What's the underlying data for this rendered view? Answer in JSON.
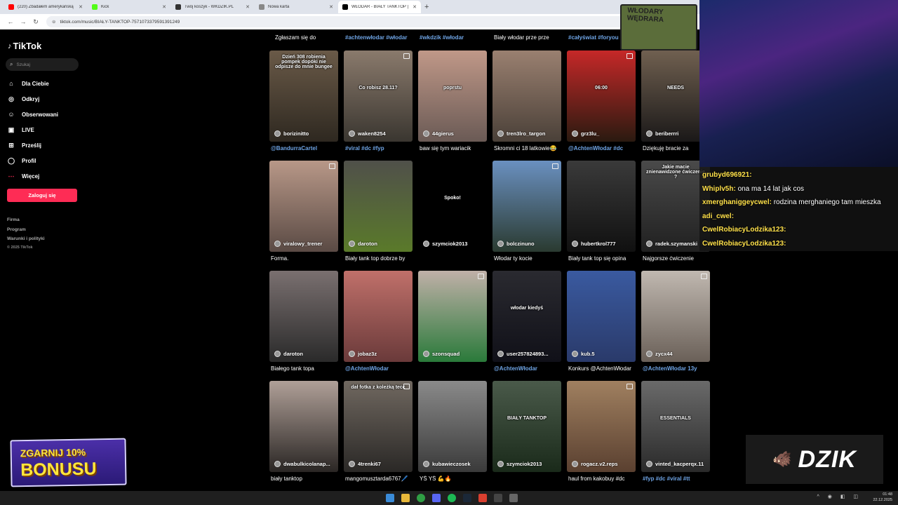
{
  "browser": {
    "tabs": [
      {
        "title": "(220) Zbadałem amerykańską",
        "icon_color": "#ff0000"
      },
      {
        "title": "Kick",
        "icon_color": "#53fc18"
      },
      {
        "title": "Twój koszyk - WKDZIK.PL",
        "icon_color": "#333333"
      },
      {
        "title": "Nowa karta",
        "icon_color": "#888888"
      },
      {
        "title": "WŁODAR - BIAŁY TANKTOP | Ti",
        "icon_color": "#000000"
      }
    ],
    "url": "tiktok.com/music/BIAŁY-TANKTOP-7571073379591391249"
  },
  "tiktok": {
    "logo": "TikTok",
    "search_placeholder": "Szukaj",
    "nav": [
      "Dla Ciebie",
      "Odkryj",
      "Obserwowani",
      "LIVE",
      "Prześlij",
      "Profil",
      "Więcej"
    ],
    "login": "Zaloguj się",
    "footer": [
      "Firma",
      "Program",
      "Warunki i polityki"
    ],
    "copyright": "© 2025 TikTok",
    "top_captions": [
      "Zgłaszam się do",
      "#achtenwłodar #włodar",
      "#wkdzik #włodar",
      "Biały włodar prze prze",
      "#całyświat #foryou"
    ],
    "rows": [
      [
        {
          "user": "borizinitto",
          "overlay": "Dzień 308 robienia pompek dopóki nie odpisze do mnie bungee",
          "caption": "@BandurraCartel",
          "caption_blue": true,
          "colors": [
            "#6a5a48",
            "#2e2820"
          ]
        },
        {
          "user": "waken8254",
          "overlay": "Co robisz 28.11?",
          "caption": "#viral #dc #fyp",
          "caption_blue": true,
          "colors": [
            "#8a7a6c",
            "#3a3630"
          ]
        },
        {
          "user": "44gierus",
          "overlay": "poprstu",
          "caption": "baw się tym wariacik",
          "caption_blue": false,
          "colors": [
            "#c09888",
            "#6a5a55"
          ]
        },
        {
          "user": "tren3lro_targon",
          "overlay": "",
          "caption": "Skromni ci 18 latkowie😂",
          "caption_blue": false,
          "colors": [
            "#9a8070",
            "#4a4038"
          ]
        },
        {
          "user": "grz3lu_",
          "overlay": "06:00",
          "caption": "@AchtenWłodar #dc",
          "caption_blue": true,
          "colors": [
            "#c62828",
            "#2a1a10"
          ]
        },
        {
          "user": "beriberrri",
          "overlay": "NEEDS",
          "caption": "Dziękuję bracie za",
          "caption_blue": false,
          "colors": [
            "#706050",
            "#1a1818"
          ]
        }
      ],
      [
        {
          "user": "viralowy_trener",
          "overlay": "",
          "caption": "Forma.",
          "caption_blue": false,
          "colors": [
            "#b89888",
            "#5a4a44"
          ]
        },
        {
          "user": "daroton",
          "overlay": "",
          "caption": "Biały tank top dobrze by",
          "caption_blue": false,
          "colors": [
            "#50504a",
            "#5a7a2a"
          ]
        },
        {
          "user": "szymciok2013",
          "overlay": "Spoko!",
          "caption": "",
          "caption_blue": false,
          "colors": [
            "#000000",
            "#000000"
          ]
        },
        {
          "user": "bolczinuno",
          "overlay": "",
          "caption": "Włodar ty kocie",
          "caption_blue": false,
          "colors": [
            "#6a90c0",
            "#2a3a30"
          ]
        },
        {
          "user": "hubertkrol777",
          "overlay": "",
          "caption": "Biały tank top się opina",
          "caption_blue": false,
          "colors": [
            "#3a3a3a",
            "#101010"
          ]
        },
        {
          "user": "radek.szymanski",
          "overlay": "Jakie macie znienawidzone ćwiczenie ?",
          "caption": "Najgorsze ćwiczenie",
          "caption_blue": false,
          "colors": [
            "#4a4a4a",
            "#202020"
          ]
        }
      ],
      [
        {
          "user": "daroton",
          "overlay": "",
          "caption": "Białego tank topa",
          "caption_blue": false,
          "colors": [
            "#7a7070",
            "#2a2a2a"
          ]
        },
        {
          "user": "jobaz3z",
          "overlay": "",
          "caption": "@AchtenWłodar",
          "caption_blue": true,
          "colors": [
            "#c0706a",
            "#6a3a3a"
          ]
        },
        {
          "user": "szonsquad",
          "overlay": "",
          "caption": "",
          "caption_blue": false,
          "colors": [
            "#c0b0a8",
            "#2a7a3a"
          ]
        },
        {
          "user": "user257824893...",
          "overlay": "włodar kiedyś",
          "caption": "@AchtenWłodar",
          "caption_blue": true,
          "colors": [
            "#2a2a30",
            "#101018"
          ]
        },
        {
          "user": "kub.5",
          "overlay": "",
          "caption": "Konkurs @AchtenWłodar",
          "caption_blue": false,
          "colors": [
            "#3a5aa0",
            "#2a3a6a"
          ]
        },
        {
          "user": "zycx44",
          "overlay": "",
          "caption": "@AchtenWłodar 13y",
          "caption_blue": true,
          "colors": [
            "#c0b8b0",
            "#6a6058"
          ]
        }
      ],
      [
        {
          "user": "dwabulkicolanap...",
          "overlay": "",
          "caption": "biały tanktop",
          "caption_blue": false,
          "colors": [
            "#b0a098",
            "#2a2624"
          ]
        },
        {
          "user": "4trenki67",
          "overlay": "dał fotka z koleżką tecc",
          "caption": "mangomusztarda6767🖊️",
          "caption_blue": false,
          "colors": [
            "#706860",
            "#2a2826"
          ]
        },
        {
          "user": "kubawieczosek",
          "overlay": "",
          "caption": "YŚ YŚ 💪🔥",
          "caption_blue": false,
          "colors": [
            "#8a8a8a",
            "#3a3a3a"
          ]
        },
        {
          "user": "szymciok2013",
          "overlay": "BIAŁY TANKTOP",
          "caption": "",
          "caption_blue": false,
          "colors": [
            "#4a5a4a",
            "#1a2a1a"
          ]
        },
        {
          "user": "rogacz.v2.reps",
          "overlay": "",
          "caption": "haul from kakobuy #dc",
          "caption_blue": false,
          "colors": [
            "#a08060",
            "#5a4030"
          ]
        },
        {
          "user": "vinted_kacperqx.11",
          "overlay": "ESSENTIALS",
          "caption": "#fyp #dc #viral #tt",
          "caption_blue": true,
          "colors": [
            "#6a6a6a",
            "#2a2a2a"
          ]
        }
      ]
    ]
  },
  "stream": {
    "badge": "WŁODARY WĘDRARA",
    "chat": [
      {
        "name": "grubyd696921:",
        "text": ""
      },
      {
        "name": "Whiplv5h:",
        "text": "ona ma 14 lat jak cos"
      },
      {
        "name": "xmerghaniggeycwel:",
        "text": "rodzina merghaniego tam mieszka"
      },
      {
        "name": "adi_cwel:",
        "text": ""
      },
      {
        "name": "CwelRobiacyLodzika123:",
        "text": ""
      },
      {
        "name": "CwelRobiacyLodzika123:",
        "text": ""
      }
    ],
    "bonus_line1": "ZGARNIJ 10%",
    "bonus_line2": "BONUSU",
    "sponsor": "DZIK"
  },
  "taskbar": {
    "time": "01:48",
    "date": "22.12.2025"
  }
}
